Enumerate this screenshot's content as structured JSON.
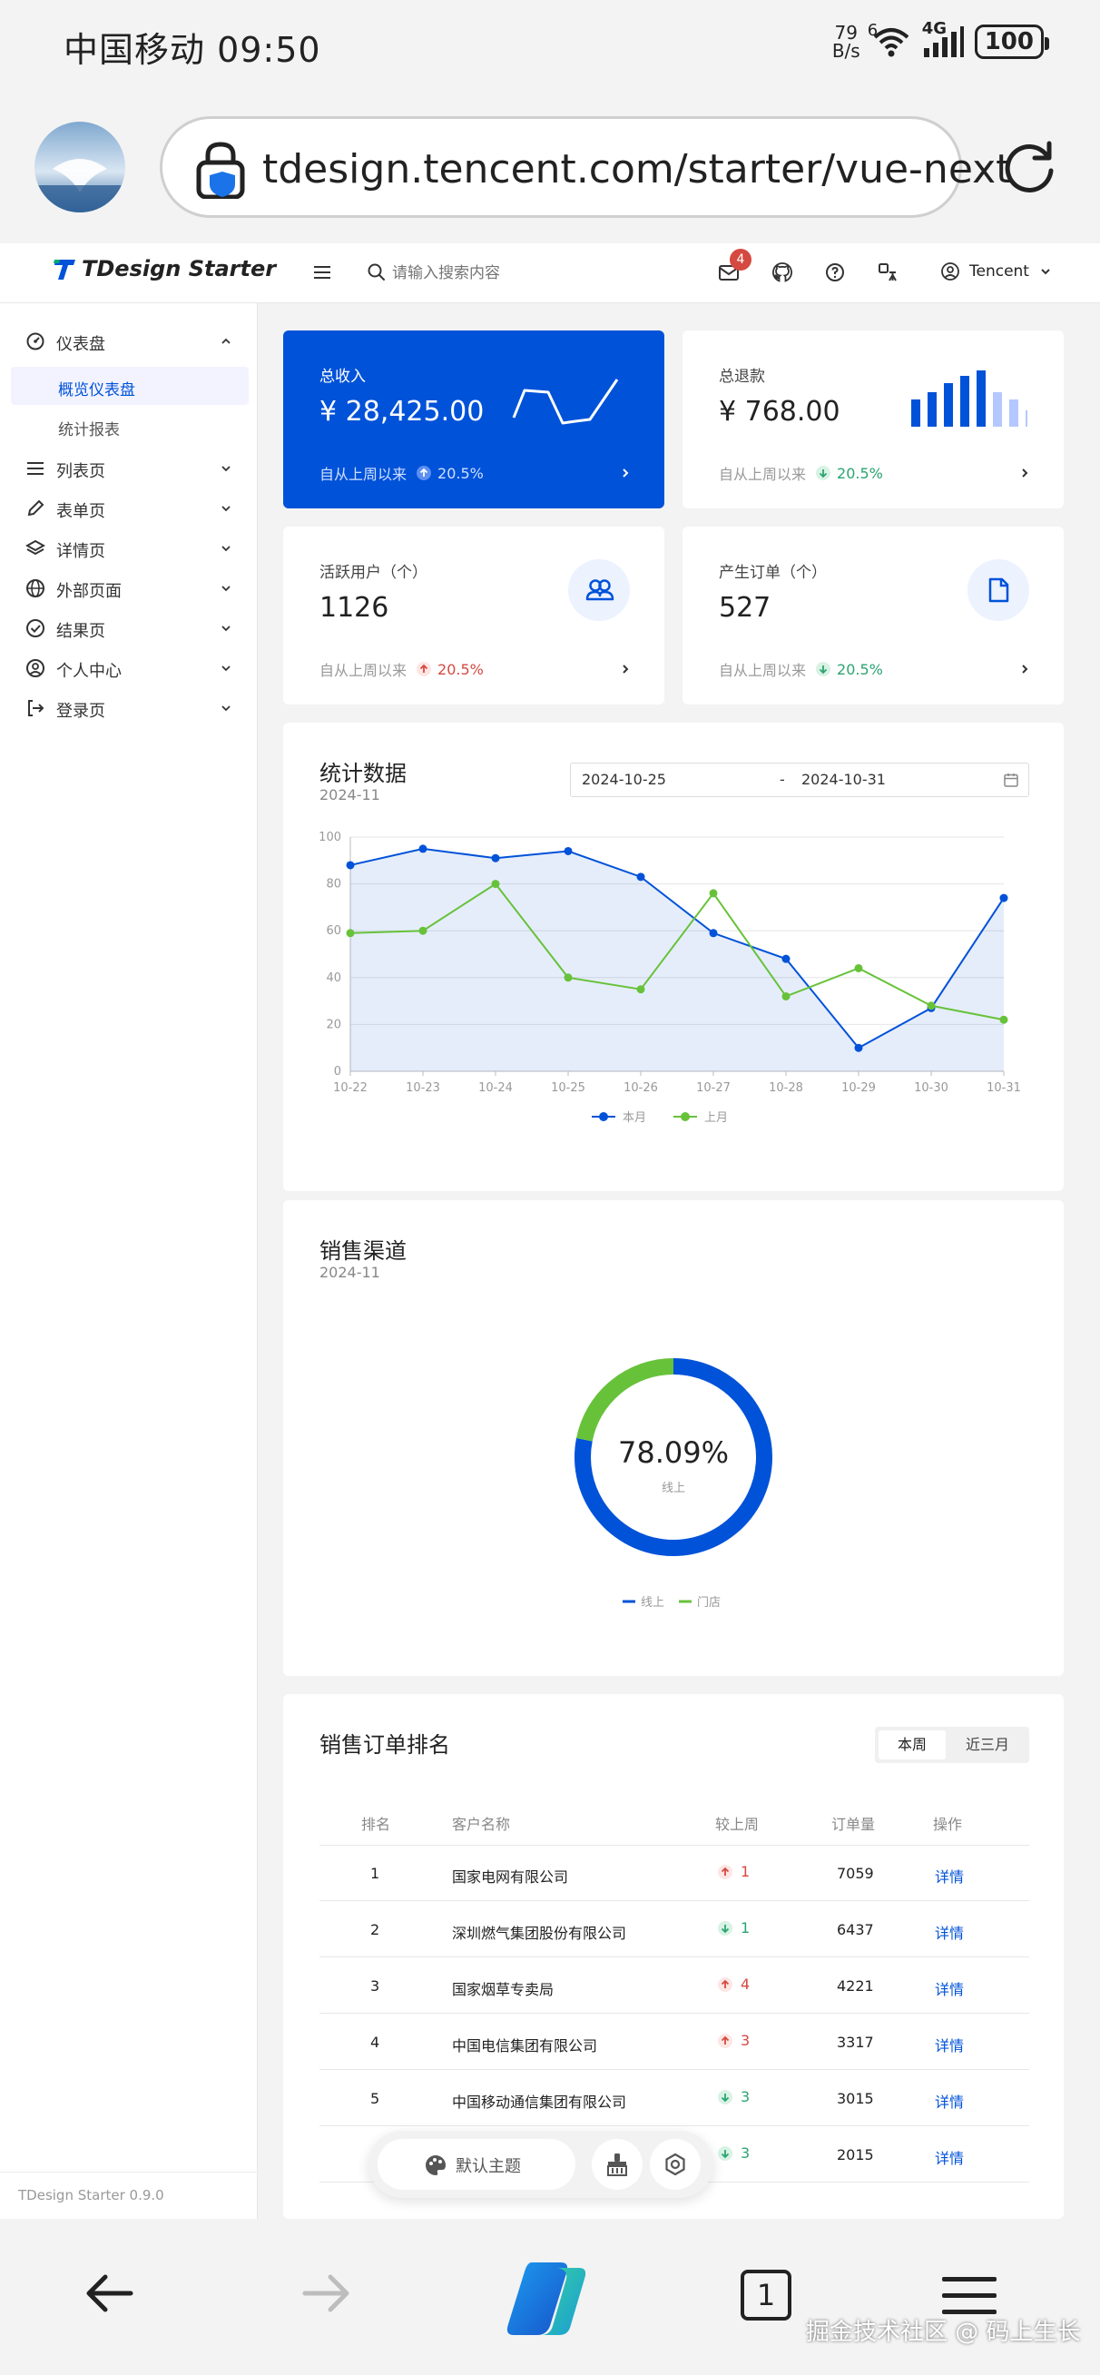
{
  "status_bar": {
    "carrier_time": "中国移动 09:50",
    "net_speed_value": "79",
    "net_speed_unit": "B/s",
    "wifi_number": "6",
    "network": "4G",
    "battery": "100"
  },
  "browser": {
    "url": "tdesign.tencent.com/starter/vue-next",
    "tab_count": "1"
  },
  "header": {
    "logo_text": "TDesign Starter",
    "search_placeholder": "请输入搜索内容",
    "notification_count": "4",
    "user_name": "Tencent",
    "icons": [
      "menu-icon",
      "search-icon",
      "mail-icon",
      "github-icon",
      "help-icon",
      "translate-icon",
      "user-circle-icon",
      "chevron-down-icon"
    ]
  },
  "sidebar": {
    "groups": [
      {
        "label": "仪表盘",
        "icon": "dashboard-icon",
        "expanded": true,
        "children": [
          {
            "label": "概览仪表盘",
            "active": true
          },
          {
            "label": "统计报表",
            "active": false
          }
        ]
      },
      {
        "label": "列表页",
        "icon": "list-icon"
      },
      {
        "label": "表单页",
        "icon": "edit-icon"
      },
      {
        "label": "详情页",
        "icon": "layers-icon"
      },
      {
        "label": "外部页面",
        "icon": "globe-icon"
      },
      {
        "label": "结果页",
        "icon": "check-circle-icon"
      },
      {
        "label": "个人中心",
        "icon": "user-circle-icon"
      },
      {
        "label": "登录页",
        "icon": "login-icon"
      }
    ],
    "version": "TDesign Starter 0.9.0"
  },
  "metrics": [
    {
      "title": "总收入",
      "value": "¥ 28,425.00",
      "since": "自从上周以来",
      "trend": "20.5%",
      "direction": "up"
    },
    {
      "title": "总退款",
      "value": "¥ 768.00",
      "since": "自从上周以来",
      "trend": "20.5%",
      "direction": "down"
    },
    {
      "title": "活跃用户（个）",
      "value": "1126",
      "since": "自从上周以来",
      "trend": "20.5%",
      "direction": "up"
    },
    {
      "title": "产生订单（个）",
      "value": "527",
      "since": "自从上周以来",
      "trend": "20.5%",
      "direction": "down"
    }
  ],
  "stats": {
    "title": "统计数据",
    "subtitle": "2024-11",
    "date_start": "2024-10-25",
    "date_sep": "-",
    "date_end": "2024-10-31"
  },
  "chart_data": [
    {
      "type": "line",
      "x": [
        "10-22",
        "10-23",
        "10-24",
        "10-25",
        "10-26",
        "10-27",
        "10-28",
        "10-29",
        "10-30",
        "10-31"
      ],
      "ylim": [
        0,
        100
      ],
      "yticks": [
        0,
        20,
        40,
        60,
        80,
        100
      ],
      "grid": true,
      "legend_position": "bottom",
      "series": [
        {
          "name": "本月",
          "color": "#0052d9",
          "area": true,
          "values": [
            88,
            95,
            91,
            94,
            83,
            59,
            48,
            10,
            27,
            74
          ]
        },
        {
          "name": "上月",
          "color": "#67c23a",
          "area": false,
          "values": [
            59,
            60,
            80,
            40,
            35,
            76,
            32,
            44,
            28,
            22
          ]
        }
      ]
    },
    {
      "type": "pie",
      "donut": true,
      "center_value": "78.09%",
      "center_label": "线上",
      "legend_position": "bottom",
      "slices": [
        {
          "name": "线上",
          "value": 78.09,
          "color": "#0052d9"
        },
        {
          "name": "门店",
          "value": 21.91,
          "color": "#67c23a"
        }
      ]
    }
  ],
  "sales_channel": {
    "title": "销售渠道",
    "subtitle": "2024-11"
  },
  "ranking": {
    "title": "销售订单排名",
    "tabs": [
      "本周",
      "近三月"
    ],
    "columns": [
      "排名",
      "客户名称",
      "较上周",
      "订单量",
      "操作"
    ],
    "rows": [
      {
        "rank": "1",
        "name": "国家电网有限公司",
        "change": "1",
        "direction": "up",
        "orders": "7059",
        "action": "详情"
      },
      {
        "rank": "2",
        "name": "深圳燃气集团股份有限公司",
        "change": "1",
        "direction": "down",
        "orders": "6437",
        "action": "详情"
      },
      {
        "rank": "3",
        "name": "国家烟草专卖局",
        "change": "4",
        "direction": "up",
        "orders": "4221",
        "action": "详情"
      },
      {
        "rank": "4",
        "name": "中国电信集团有限公司",
        "change": "3",
        "direction": "up",
        "orders": "3317",
        "action": "详情"
      },
      {
        "rank": "5",
        "name": "中国移动通信集团有限公司",
        "change": "3",
        "direction": "down",
        "orders": "3015",
        "action": "详情"
      },
      {
        "rank": "",
        "name": "",
        "change": "3",
        "direction": "down",
        "orders": "2015",
        "action": "详情"
      }
    ]
  },
  "theme_pill": {
    "label": "默认主题"
  },
  "watermark": "掘金技术社区 @ 码上生长",
  "colors": {
    "brand": "#0052d9",
    "success": "#2ba471",
    "error": "#d54941",
    "green_series": "#67c23a"
  }
}
